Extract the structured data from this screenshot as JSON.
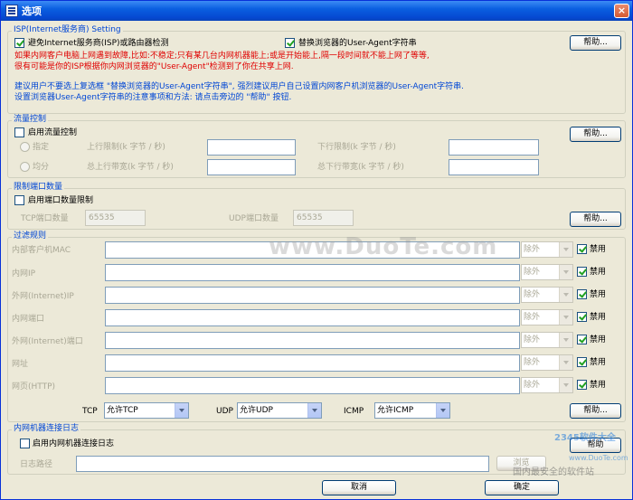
{
  "window": {
    "title": "选项",
    "close": "×"
  },
  "isp": {
    "group_title": "ISP(Internet服务商) Setting",
    "avoid_label": "避免Internet服务商(ISP)或路由器检测",
    "avoid_checked": true,
    "ua_label": "替换浏览器的User-Agent字符串",
    "ua_checked": true,
    "help": "帮助...",
    "warn_line1": "如果内网客户电脑上网遇到故障,比如:不稳定;只有某几台内网机器能上;或是开始能上,隔一段时间就不能上网了等等,",
    "warn_line2": "很有可能是你的ISP根据你内网浏览器的\"User-Agent\"检测到了你在共享上网.",
    "info_line1": "建议用户不要选上复选框 \"替换浏览器的User-Agent字符串\", 强烈建议用户自己设置内网客户机浏览器的User-Agent字符串.",
    "info_line2": "设置浏览器User-Agent字符串的注意事项和方法: 请点击旁边的 \"帮助\" 按钮."
  },
  "flow": {
    "group_title": "流量控制",
    "enable_label": "启用流量控制",
    "enable_checked": false,
    "help": "帮助...",
    "fixed_label": "指定",
    "avg_label": "均分",
    "up_limit_label": "上行限制(k 字节 / 秒)",
    "down_limit_label": "下行限制(k 字节 / 秒)",
    "total_up_label": "总上行带宽(k 字节 / 秒)",
    "total_down_label": "总下行带宽(k 字节 / 秒)",
    "up_limit_value": "",
    "down_limit_value": "",
    "total_up_value": "",
    "total_down_value": ""
  },
  "ports": {
    "group_title": "限制端口数量",
    "enable_label": "启用端口数量限制",
    "enable_checked": false,
    "tcp_label": "TCP端口数量",
    "tcp_value": "65535",
    "udp_label": "UDP端口数量",
    "udp_value": "65535",
    "help": "帮助..."
  },
  "filter": {
    "group_title": "过滤规则",
    "rows": [
      {
        "label": "内部客户机MAC",
        "value": "",
        "mode": "除外",
        "ban_label": "禁用",
        "ban_checked": true
      },
      {
        "label": "内网IP",
        "value": "",
        "mode": "除外",
        "ban_label": "禁用",
        "ban_checked": true
      },
      {
        "label": "外网(Internet)IP",
        "value": "",
        "mode": "除外",
        "ban_label": "禁用",
        "ban_checked": true
      },
      {
        "label": "内网端口",
        "value": "",
        "mode": "除外",
        "ban_label": "禁用",
        "ban_checked": true
      },
      {
        "label": "外网(Internet)端口",
        "value": "",
        "mode": "除外",
        "ban_label": "禁用",
        "ban_checked": true
      },
      {
        "label": "网址",
        "value": "",
        "mode": "除外",
        "ban_label": "禁用",
        "ban_checked": true
      },
      {
        "label": "网页(HTTP)",
        "value": "",
        "mode": "除外",
        "ban_label": "禁用",
        "ban_checked": true
      }
    ],
    "tcp_label": "TCP",
    "tcp_value": "允许TCP",
    "udp_label": "UDP",
    "udp_value": "允许UDP",
    "icmp_label": "ICMP",
    "icmp_value": "允许ICMP",
    "help": "帮助..."
  },
  "log": {
    "group_title": "内网机器连接日志",
    "enable_label": "启用内网机器连接日志",
    "enable_checked": false,
    "path_label": "日志路径",
    "path_value": "",
    "browse": "浏览",
    "help": "帮助"
  },
  "footer": {
    "cancel": "取消",
    "ok": "确定"
  },
  "watermarks": {
    "center": "www.DuoTe.com",
    "corner_site": "www.DuoTe.com",
    "corner_brand": "2345软件大全",
    "corner_slogan": "国内最安全的软件站"
  }
}
